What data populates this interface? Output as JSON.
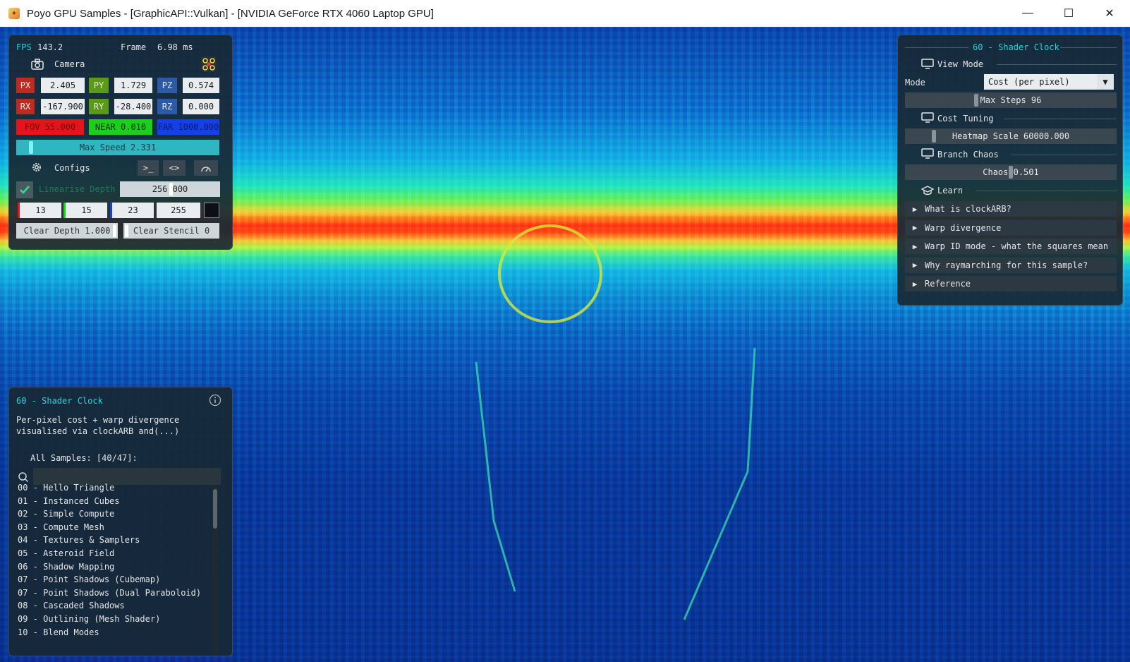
{
  "window": {
    "title": "Poyo GPU Samples - [GraphicAPI::Vulkan] - [NVIDIA GeForce RTX 4060 Laptop GPU]",
    "minimize": "—",
    "maximize": "☐",
    "close": "✕"
  },
  "stats": {
    "fps_label": "FPS",
    "fps": "143.2",
    "frame_label": "Frame",
    "frame": "6.98 ms"
  },
  "camera": {
    "title": "Camera",
    "px_label": "PX",
    "px": "2.405",
    "py_label": "PY",
    "py": "1.729",
    "pz_label": "PZ",
    "pz": "0.574",
    "rx_label": "RX",
    "rx": "-167.900",
    "ry_label": "RY",
    "ry": "-28.400",
    "rz_label": "RZ",
    "rz": "0.000",
    "fov": "FOV 55.000",
    "near": "NEAR 0.010",
    "far": "FAR 1000.000",
    "max_speed": "Max Speed 2.331",
    "max_speed_fraction": 0.05
  },
  "configs": {
    "title": "Configs",
    "linearise_label": "Linearise Depth",
    "linearise_checked": true,
    "depth_value": "256.000",
    "clear_r": "13",
    "clear_g": "15",
    "clear_b": "23",
    "clear_a": "255",
    "clear_depth": "Clear Depth 1.000",
    "clear_stencil": "Clear Stencil 0"
  },
  "info_panel": {
    "title": "60 - Shader Clock",
    "description": "Per-pixel cost + warp divergence visualised via clockARB and(...)",
    "samples_header": "All Samples: [40/47]:",
    "search_value": "",
    "samples": [
      "00 - Hello Triangle",
      "01 - Instanced Cubes",
      "02 - Simple Compute",
      "03 - Compute Mesh",
      "04 - Textures & Samplers",
      "05 - Asteroid Field",
      "06 - Shadow Mapping",
      "07 - Point Shadows (Cubemap)",
      "07 - Point Shadows (Dual Paraboloid)",
      "08 - Cascaded Shadows",
      "09 - Outlining (Mesh Shader)",
      "10 - Blend Modes"
    ]
  },
  "right_panel": {
    "title": "60 - Shader Clock",
    "view_mode_header": "View Mode",
    "mode_label": "Mode",
    "mode_value": "Cost (per pixel)",
    "max_steps": "Max Steps 96",
    "max_steps_fraction": 0.33,
    "cost_tuning_header": "Cost Tuning",
    "heatmap_scale": "Heatmap Scale 60000.000",
    "heatmap_fraction": 0.12,
    "branch_chaos_header": "Branch Chaos",
    "chaos": "Chaos 0.501",
    "chaos_fraction": 0.5,
    "learn_header": "Learn",
    "learn_items": [
      "What is clockARB?",
      "Warp divergence",
      "Warp ID mode - what the squares mean",
      "Why raymarching for this sample?",
      "Reference"
    ]
  },
  "colors": {
    "accent_cyan": "#26d4d8",
    "red_field": "#e4141a",
    "green_field": "#1ad01a",
    "blue_field": "#1440e8",
    "px_red": "#c0291e",
    "py_green": "#5a9a14",
    "pz_blue": "#2a5aa8"
  }
}
